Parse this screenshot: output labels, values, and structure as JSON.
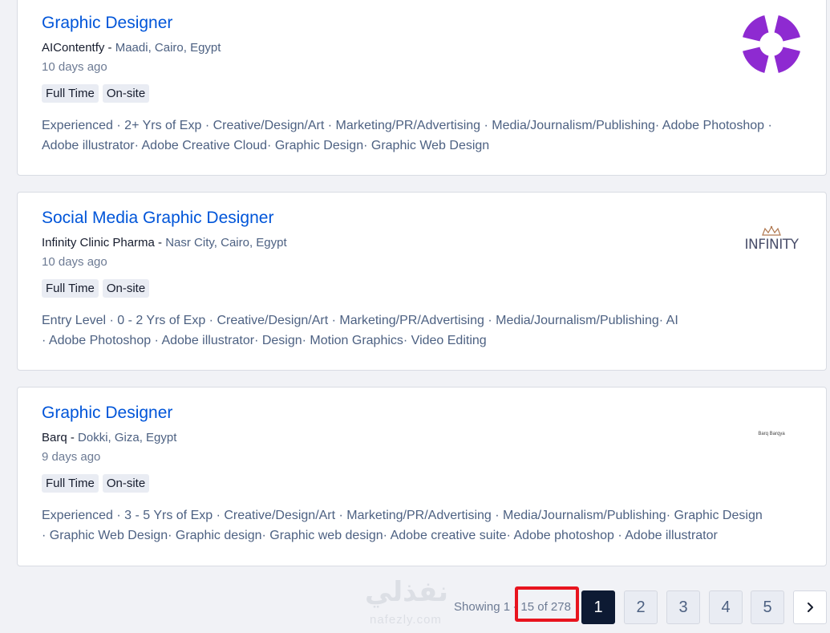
{
  "jobs": [
    {
      "title": "Graphic Designer",
      "company": "AIContentfy -",
      "location": "Maadi, Cairo, Egypt",
      "posted": "10 days ago",
      "tags": [
        "Full Time",
        "On-site"
      ],
      "skills_line1": "Experienced · 2+ Yrs of Exp · Creative/Design/Art · Marketing/PR/Advertising · Media/Journalism/Publishing· Adobe Photoshop ·",
      "skills_line2": "Adobe illustrator· Adobe Creative Cloud· Graphic Design· Graphic Web Design"
    },
    {
      "title": "Social Media Graphic Designer",
      "company": "Infinity Clinic Pharma -",
      "location": "Nasr City, Cairo, Egypt",
      "posted": "10 days ago",
      "tags": [
        "Full Time",
        "On-site"
      ],
      "skills_line1": "Entry Level · 0 - 2 Yrs of Exp · Creative/Design/Art · Marketing/PR/Advertising · Media/Journalism/Publishing· AI",
      "skills_line2": "· Adobe Photoshop · Adobe illustrator· Design· Motion Graphics· Video Editing",
      "logo_text": "INFINITY"
    },
    {
      "title": "Graphic Designer",
      "company": "Barq -",
      "location": "Dokki, Giza, Egypt",
      "posted": "9 days ago",
      "tags": [
        "Full Time",
        "On-site"
      ],
      "skills_line1": "Experienced · 3 - 5 Yrs of Exp · Creative/Design/Art · Marketing/PR/Advertising · Media/Journalism/Publishing· Graphic Design",
      "skills_line2": "· Graphic Web Design· Graphic design· Graphic web design· Adobe creative suite· Adobe photoshop · Adobe illustrator",
      "logo_text": "Barq Barqya"
    }
  ],
  "pagination": {
    "showing_prefix": "Showing 1 -",
    "showing_range": "15 of 278",
    "pages": [
      "1",
      "2",
      "3",
      "4",
      "5"
    ],
    "active_page": "1",
    "next_label": "›"
  },
  "watermark": {
    "arabic": "نفذلي",
    "latin": "nafezly.com"
  },
  "colors": {
    "title_link": "#0055d9",
    "active_page_bg": "#0d1a33",
    "highlight_box": "#e8141e",
    "logo_purple": "#8e2ad1"
  }
}
